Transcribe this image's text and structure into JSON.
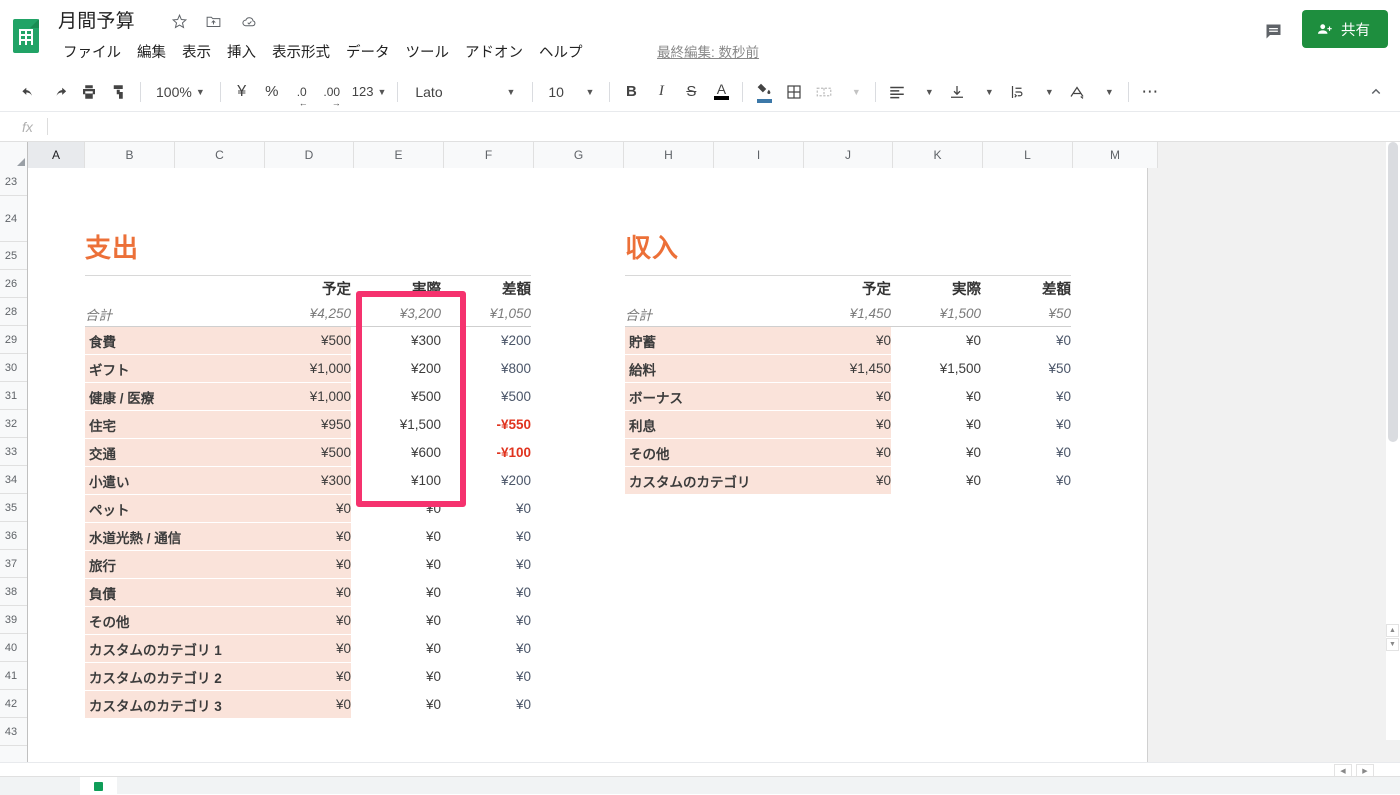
{
  "app": {
    "logo_icon": "google-sheets-icon",
    "doc_title": "月間予算",
    "star_icon": "star-icon",
    "move_icon": "move-to-folder-icon",
    "cloud_icon": "cloud-saved-icon",
    "last_edit": "最終編集: 数秒前",
    "comment_icon": "comment-icon",
    "share_icon": "person-add-icon",
    "share_label": "共有"
  },
  "menubar": {
    "items": [
      {
        "label": "ファイル",
        "name": "menu-file"
      },
      {
        "label": "編集",
        "name": "menu-edit"
      },
      {
        "label": "表示",
        "name": "menu-view"
      },
      {
        "label": "挿入",
        "name": "menu-insert"
      },
      {
        "label": "表示形式",
        "name": "menu-format"
      },
      {
        "label": "データ",
        "name": "menu-data"
      },
      {
        "label": "ツール",
        "name": "menu-tools"
      },
      {
        "label": "アドオン",
        "name": "menu-addons"
      },
      {
        "label": "ヘルプ",
        "name": "menu-help"
      }
    ]
  },
  "toolbar": {
    "undo_icon": "undo-icon",
    "redo_icon": "redo-icon",
    "print_icon": "print-icon",
    "paint_format_icon": "paint-format-icon",
    "zoom_value": "100%",
    "currency_icon": "yen-currency-icon",
    "percent_icon": "percent-icon",
    "decrease_decimal_icon": "decrease-decimal-icon",
    "increase_decimal_icon": "increase-decimal-icon",
    "more_formats_label": "123",
    "font_family": "Lato",
    "font_size": "10",
    "bold_label": "B",
    "italic_label": "I",
    "strikethrough_label": "S",
    "text_color_label": "A",
    "fill_color_icon": "fill-color-icon",
    "borders_icon": "borders-icon",
    "merge_cells_icon": "merge-cells-icon",
    "halign_icon": "horizontal-align-icon",
    "valign_icon": "vertical-align-icon",
    "text_wrap_icon": "text-wrapping-icon",
    "text_rotation_icon": "text-rotation-icon",
    "more_icon": "more-options-icon",
    "collapse_icon": "chevron-up-icon"
  },
  "formula_bar": {
    "fx_label": "fx",
    "value": "",
    "placeholder": ""
  },
  "grid": {
    "columns": [
      "A",
      "B",
      "C",
      "D",
      "E",
      "F",
      "G",
      "H",
      "I",
      "J",
      "K",
      "L",
      "M"
    ],
    "selected_column": "A",
    "rows": [
      "23",
      "24",
      "25",
      "26",
      "28",
      "29",
      "30",
      "31",
      "32",
      "33",
      "34",
      "35",
      "36",
      "37",
      "38",
      "39",
      "40",
      "41",
      "42",
      "43"
    ]
  },
  "annotation": {
    "color": "#f5326e",
    "shape": "rectangle",
    "target": "expenses-actual-column"
  },
  "sheet": {
    "expenses": {
      "title": "支出",
      "headers": {
        "label": "",
        "planned": "予定",
        "actual": "実際",
        "difference": "差額"
      },
      "total": {
        "label": "合計",
        "planned": "¥4,250",
        "actual": "¥3,200",
        "difference": "¥1,050",
        "difference_negative": false
      },
      "rows": [
        {
          "label": "食費",
          "planned": "¥500",
          "actual": "¥300",
          "difference": "¥200",
          "difference_negative": false
        },
        {
          "label": "ギフト",
          "planned": "¥1,000",
          "actual": "¥200",
          "difference": "¥800",
          "difference_negative": false
        },
        {
          "label": "健康 / 医療",
          "planned": "¥1,000",
          "actual": "¥500",
          "difference": "¥500",
          "difference_negative": false
        },
        {
          "label": "住宅",
          "planned": "¥950",
          "actual": "¥1,500",
          "difference": "-¥550",
          "difference_negative": true
        },
        {
          "label": "交通",
          "planned": "¥500",
          "actual": "¥600",
          "difference": "-¥100",
          "difference_negative": true
        },
        {
          "label": "小遣い",
          "planned": "¥300",
          "actual": "¥100",
          "difference": "¥200",
          "difference_negative": false
        },
        {
          "label": "ペット",
          "planned": "¥0",
          "actual": "¥0",
          "difference": "¥0",
          "difference_negative": false
        },
        {
          "label": "水道光熱 / 通信",
          "planned": "¥0",
          "actual": "¥0",
          "difference": "¥0",
          "difference_negative": false
        },
        {
          "label": "旅行",
          "planned": "¥0",
          "actual": "¥0",
          "difference": "¥0",
          "difference_negative": false
        },
        {
          "label": "負債",
          "planned": "¥0",
          "actual": "¥0",
          "difference": "¥0",
          "difference_negative": false
        },
        {
          "label": "その他",
          "planned": "¥0",
          "actual": "¥0",
          "difference": "¥0",
          "difference_negative": false
        },
        {
          "label": "カスタムのカテゴリ 1",
          "planned": "¥0",
          "actual": "¥0",
          "difference": "¥0",
          "difference_negative": false
        },
        {
          "label": "カスタムのカテゴリ 2",
          "planned": "¥0",
          "actual": "¥0",
          "difference": "¥0",
          "difference_negative": false
        },
        {
          "label": "カスタムのカテゴリ 3",
          "planned": "¥0",
          "actual": "¥0",
          "difference": "¥0",
          "difference_negative": false
        }
      ]
    },
    "income": {
      "title": "収入",
      "headers": {
        "label": "",
        "planned": "予定",
        "actual": "実際",
        "difference": "差額"
      },
      "total": {
        "label": "合計",
        "planned": "¥1,450",
        "actual": "¥1,500",
        "difference": "¥50",
        "difference_negative": false
      },
      "rows": [
        {
          "label": "貯蓄",
          "planned": "¥0",
          "actual": "¥0",
          "difference": "¥0",
          "difference_negative": false
        },
        {
          "label": "給料",
          "planned": "¥1,450",
          "actual": "¥1,500",
          "difference": "¥50",
          "difference_negative": false
        },
        {
          "label": "ボーナス",
          "planned": "¥0",
          "actual": "¥0",
          "difference": "¥0",
          "difference_negative": false
        },
        {
          "label": "利息",
          "planned": "¥0",
          "actual": "¥0",
          "difference": "¥0",
          "difference_negative": false
        },
        {
          "label": "その他",
          "planned": "¥0",
          "actual": "¥0",
          "difference": "¥0",
          "difference_negative": false
        },
        {
          "label": "カスタムのカテゴリ",
          "planned": "¥0",
          "actual": "¥0",
          "difference": "¥0",
          "difference_negative": false
        }
      ]
    }
  },
  "colors": {
    "accent_orange": "#ec7038",
    "row_fill": "#fae3da",
    "negative": "#e0331e",
    "share_green": "#1e8e3e",
    "annotation_pink": "#f5326e"
  }
}
